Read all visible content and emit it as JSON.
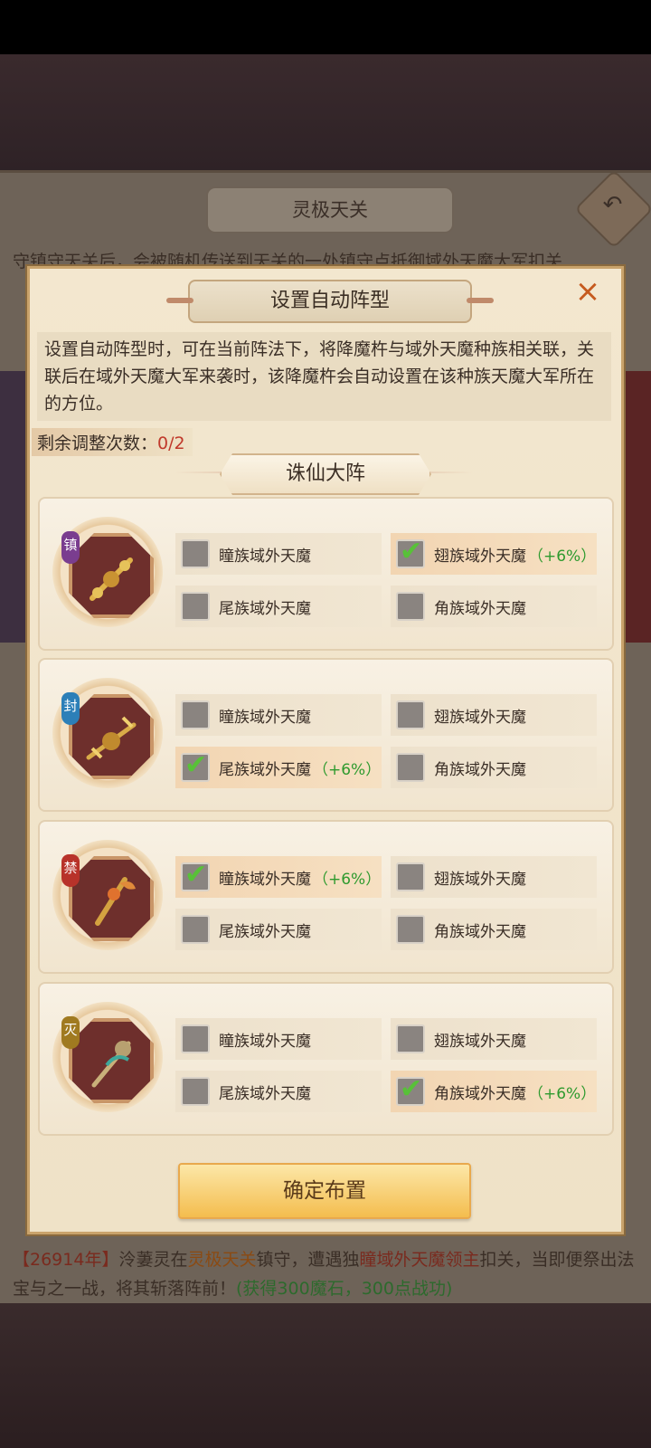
{
  "background": {
    "title": "灵极天关",
    "intro_fragment": "守镇守天关后，会被随机传送到天关的一处镇守点抵御域外天魔大军扣关",
    "log": [
      {
        "t": "【26914年】",
        "c": "b"
      },
      {
        "t": "泠萋灵在",
        "c": ""
      },
      {
        "t": "灵极天关",
        "c": "o"
      },
      {
        "t": "镇守，遭遇独",
        "c": ""
      },
      {
        "t": "瞳域外天魔领主",
        "c": "b"
      },
      {
        "t": "扣关，当即便祭出法宝与之一战，将其斩落阵前！",
        "c": ""
      },
      {
        "t": "(获得300魔石，300点战功)",
        "c": "g"
      }
    ]
  },
  "modal": {
    "title": "设置自动阵型",
    "close_icon": "×",
    "description": "设置自动阵型时，可在当前阵法下，将降魔杵与域外天魔种族相关联，关联后在域外天魔大军来袭时，该降魔杵会自动设置在该种族天魔大军所在的方位。",
    "remaining_label": "剩余调整次数：",
    "remaining_value": "0/2",
    "formation": "诛仙大阵",
    "confirm_label": "确定布置"
  },
  "rows": [
    {
      "tag": "镇",
      "tag_color": "#7a3d8f",
      "options": [
        {
          "label": "瞳族域外天魔",
          "checked": false,
          "bonus": ""
        },
        {
          "label": "翅族域外天魔",
          "checked": true,
          "bonus": "（+6%）"
        },
        {
          "label": "尾族域外天魔",
          "checked": false,
          "bonus": ""
        },
        {
          "label": "角族域外天魔",
          "checked": false,
          "bonus": ""
        }
      ]
    },
    {
      "tag": "封",
      "tag_color": "#2c7fb8",
      "options": [
        {
          "label": "瞳族域外天魔",
          "checked": false,
          "bonus": ""
        },
        {
          "label": "翅族域外天魔",
          "checked": false,
          "bonus": ""
        },
        {
          "label": "尾族域外天魔",
          "checked": true,
          "bonus": "（+6%）"
        },
        {
          "label": "角族域外天魔",
          "checked": false,
          "bonus": ""
        }
      ]
    },
    {
      "tag": "禁",
      "tag_color": "#b8322a",
      "options": [
        {
          "label": "瞳族域外天魔",
          "checked": true,
          "bonus": "（+6%）"
        },
        {
          "label": "翅族域外天魔",
          "checked": false,
          "bonus": ""
        },
        {
          "label": "尾族域外天魔",
          "checked": false,
          "bonus": ""
        },
        {
          "label": "角族域外天魔",
          "checked": false,
          "bonus": ""
        }
      ]
    },
    {
      "tag": "灭",
      "tag_color": "#a07a20",
      "options": [
        {
          "label": "瞳族域外天魔",
          "checked": false,
          "bonus": ""
        },
        {
          "label": "翅族域外天魔",
          "checked": false,
          "bonus": ""
        },
        {
          "label": "尾族域外天魔",
          "checked": false,
          "bonus": ""
        },
        {
          "label": "角族域外天魔",
          "checked": true,
          "bonus": "（+6%）"
        }
      ]
    }
  ]
}
